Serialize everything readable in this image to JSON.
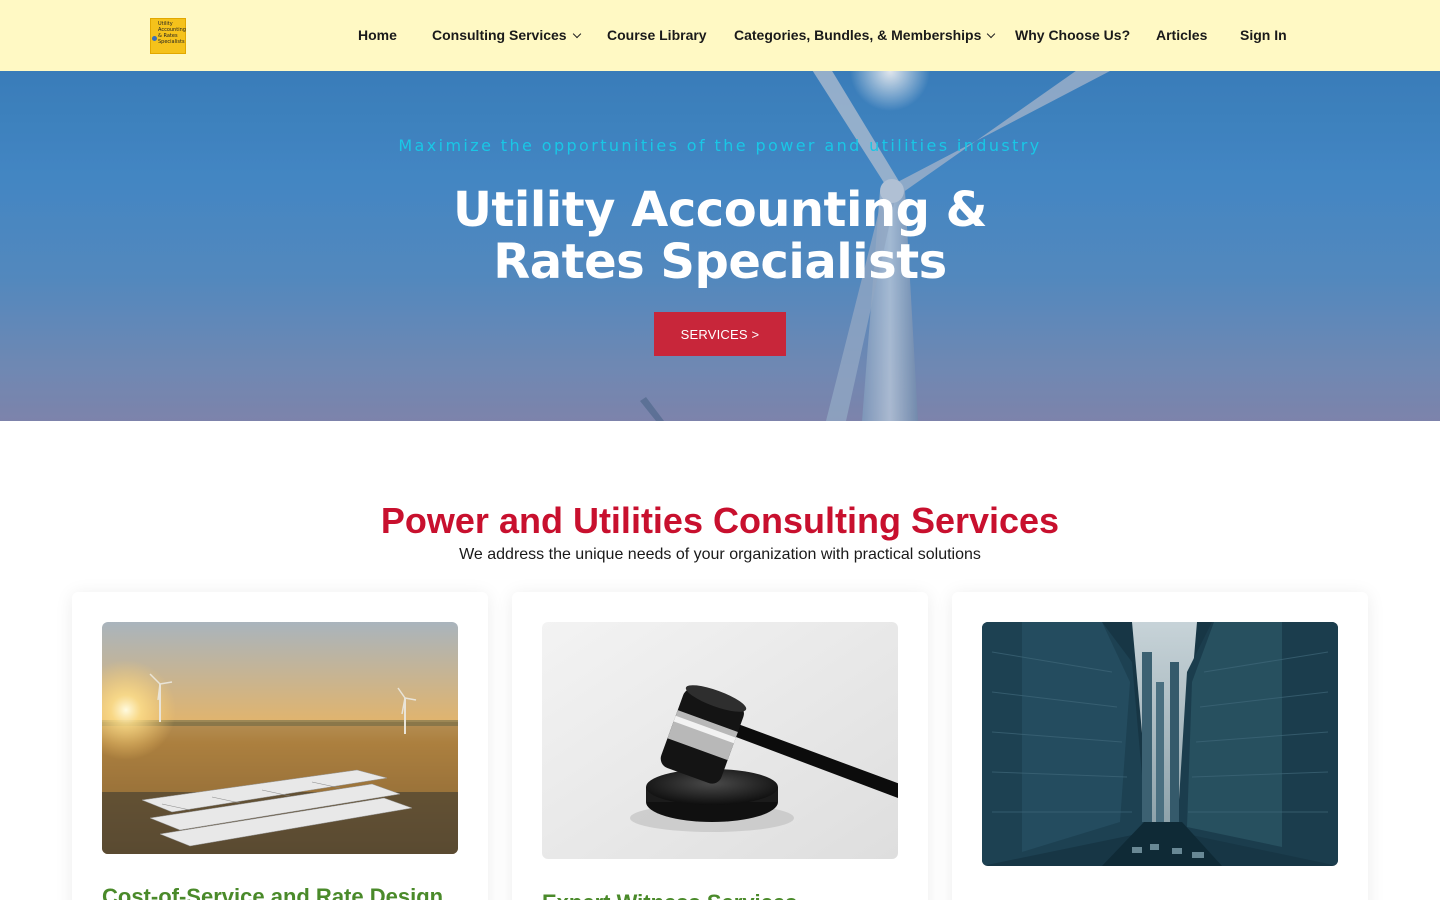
{
  "header": {
    "logo": {
      "lines": [
        "Utility",
        "Accounting",
        "& Rates",
        "Specialists"
      ],
      "icon": "logo-icon"
    },
    "nav": [
      {
        "label": "Home",
        "has_dropdown": false
      },
      {
        "label": "Consulting Services",
        "has_dropdown": true
      },
      {
        "label": "Course Library",
        "has_dropdown": false
      },
      {
        "label": "Categories, Bundles, & Memberships",
        "has_dropdown": true
      },
      {
        "label": "Why Choose Us?",
        "has_dropdown": false
      },
      {
        "label": "Articles",
        "has_dropdown": false
      },
      {
        "label": "Sign In",
        "has_dropdown": false
      }
    ],
    "background_color": "#fff9c4"
  },
  "hero": {
    "eyebrow": "Maximize the opportunities of the power and utilities industry",
    "title": "Utility Accounting & Rates Specialists",
    "button_label": "SERVICES >",
    "accent_color": "#c8263a",
    "eyebrow_color": "#19c7e6"
  },
  "services": {
    "title": "Power and Utilities Consulting Services",
    "subtitle": "We address the unique needs of your organization with practical solutions",
    "title_color": "#c8102e",
    "cards": [
      {
        "title": "Cost-of-Service and Rate Design",
        "image": "wind-farm-battery-image"
      },
      {
        "title": "Expert Witness Services",
        "image": "gavel-image"
      },
      {
        "title": "",
        "image": "city-skyscrapers-image"
      }
    ]
  }
}
